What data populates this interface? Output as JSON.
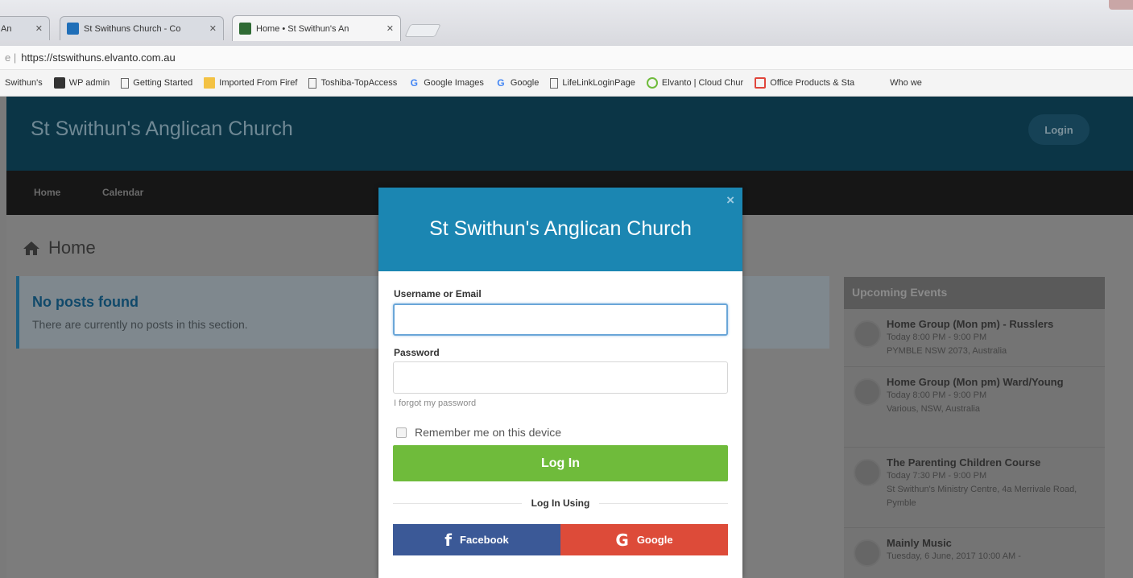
{
  "browser": {
    "tabs": [
      {
        "title": "An"
      },
      {
        "title": "St Swithuns Church - Co"
      },
      {
        "title": "Home • St Swithun's An"
      }
    ],
    "url": "https://stswithuns.elvanto.com.au",
    "bookmarks": [
      "Swithun's",
      "WP admin",
      "Getting Started",
      "Imported From Firef",
      "Toshiba-TopAccess",
      "Google Images",
      "Google",
      "LifeLinkLoginPage",
      "Elvanto | Cloud Chur",
      "Office Products & Sta",
      "Who we"
    ]
  },
  "header": {
    "site_title": "St Swithun's Anglican Church",
    "login_label": "Login"
  },
  "nav": {
    "items": [
      "Home",
      "Calendar"
    ]
  },
  "main": {
    "page_title": "Home",
    "notice_title": "No posts found",
    "notice_text": "There are currently no posts in this section."
  },
  "events": {
    "header": "Upcoming Events",
    "items": [
      {
        "title": "Home Group (Mon pm) - Russlers",
        "time": "Today 8:00 PM - 9:00 PM",
        "location": "PYMBLE NSW 2073, Australia"
      },
      {
        "title": "Home Group (Mon pm) Ward/Young",
        "time": "Today 8:00 PM - 9:00 PM",
        "location": "Various, NSW, Australia"
      },
      {
        "title": "The Parenting Children Course",
        "time": "Today 7:30 PM - 9:00 PM",
        "location": "St Swithun's Ministry Centre, 4a Merrivale Road, Pymble"
      },
      {
        "title": "Mainly Music",
        "time": "Tuesday, 6 June, 2017 10:00 AM -",
        "location": ""
      }
    ]
  },
  "modal": {
    "title": "St Swithun's Anglican Church",
    "close_glyph": "×",
    "username_label": "Username or Email",
    "username_value": "",
    "password_label": "Password",
    "password_value": "",
    "forgot_label": "I forgot my password",
    "remember_label": "Remember me on this device",
    "login_button": "Log In",
    "login_using": "Log In Using",
    "facebook_label": "Facebook",
    "google_label": "Google"
  },
  "colors": {
    "header_bg": "#0b3546",
    "modal_head": "#1b86b2",
    "login_green": "#6fbb3b",
    "facebook_blue": "#3b5997",
    "google_red": "#dd4b39"
  }
}
